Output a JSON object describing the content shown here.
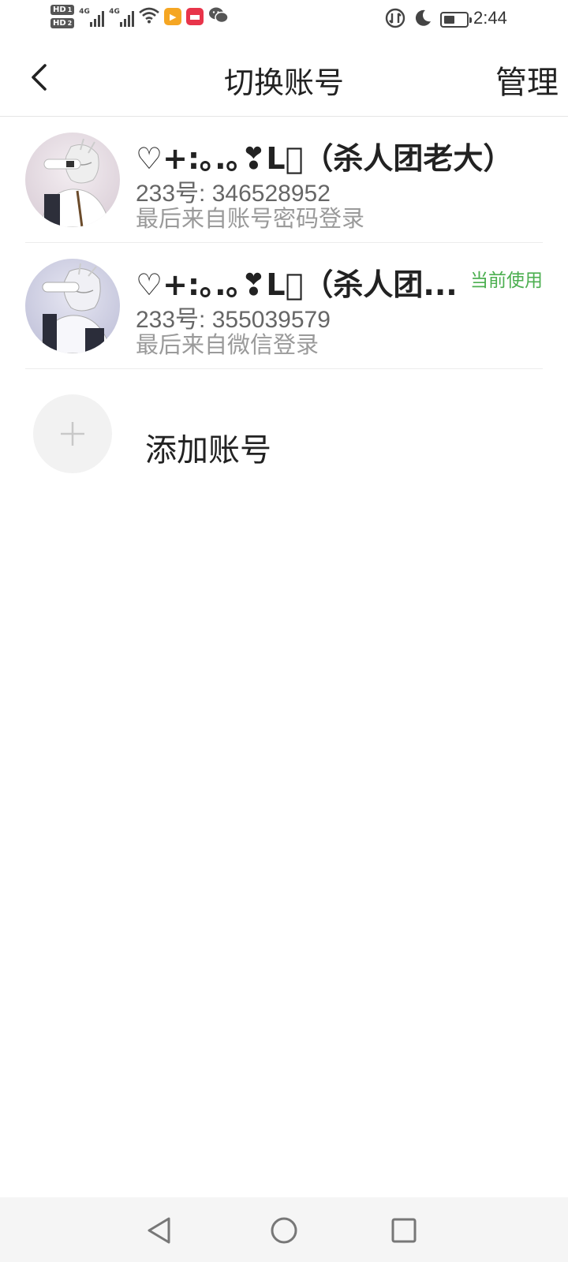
{
  "status_bar": {
    "sim1": "HD",
    "sim1_num": "1",
    "sim2": "HD",
    "sim2_num": "2",
    "net1": "4G",
    "net2": "4G",
    "time": "2:44",
    "battery_level": 0.45,
    "icons": [
      "hd-icon",
      "signal-icon",
      "wifi-icon",
      "video-app-icon",
      "shop-app-icon",
      "wechat-icon",
      "data-saver-icon",
      "moon-icon",
      "battery-icon"
    ]
  },
  "header": {
    "title": "切换账号",
    "manage_label": "管理"
  },
  "accounts": [
    {
      "name": "♡+:｡.｡❣L⃝（杀人团老大）",
      "id_line": "233号: 346528952",
      "login_line": "最后来自账号密码登录",
      "current_label": ""
    },
    {
      "name": "♡+:｡.｡❣L⃝（杀人团...",
      "id_line": "233号: 355039579",
      "login_line": "最后来自微信登录",
      "current_label": "当前使用"
    }
  ],
  "add_account": {
    "label": "添加账号"
  },
  "colors": {
    "accent_green": "#4caf50",
    "text_primary": "#222222",
    "text_secondary": "#666666",
    "text_tertiary": "#9a9a9a"
  }
}
